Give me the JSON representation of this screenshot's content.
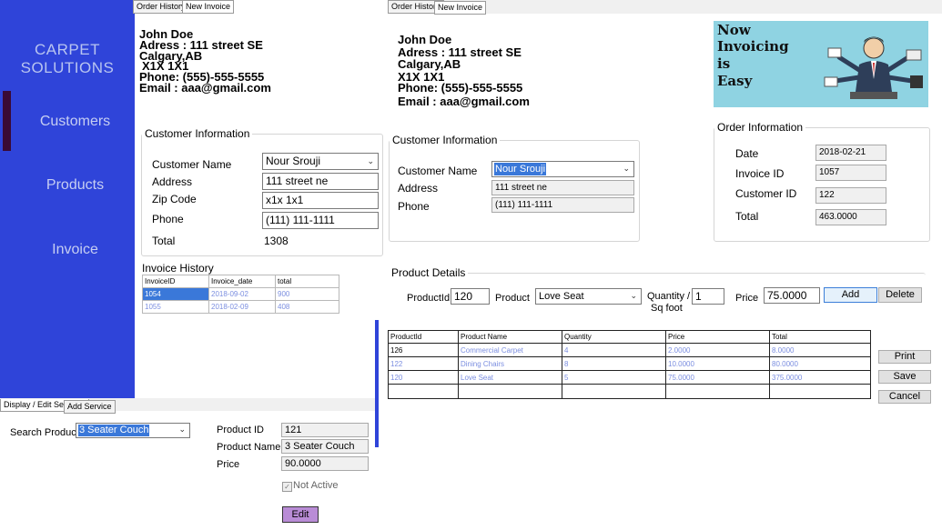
{
  "sidebar": {
    "brand_line1": "CARPET",
    "brand_line2": "SOLUTIONS",
    "items": [
      "Customers",
      "Products",
      "Invoice"
    ]
  },
  "tabs_left": [
    "Order History",
    "New Invoice"
  ],
  "tabs_right": [
    "Order History",
    "New Invoice"
  ],
  "tabs_services": [
    "Display / Edit Services",
    "Add Service"
  ],
  "company_left": {
    "name": "John Doe",
    "address": "Adress : 111 street SE",
    "city": "Calgary,AB",
    "postal": "X1X 1X1",
    "phone": "Phone: (555)-555-5555",
    "email": "Email : aaa@gmail.com"
  },
  "company_right": {
    "name": "John Doe",
    "address": "Adress : 111 street SE",
    "city": "Calgary,AB",
    "postal": "X1X 1X1",
    "phone": "Phone: (555)-555-5555",
    "email": "Email : aaa@gmail.com"
  },
  "customer_left": {
    "legend": "Customer Information",
    "name_label": "Customer Name",
    "name_value": "Nour Srouji",
    "address_label": "Address",
    "address_value": "111 street ne",
    "zip_label": "Zip Code",
    "zip_value": "x1x 1x1",
    "phone_label": "Phone",
    "phone_value": "(111) 111-1111",
    "total_label": "Total",
    "total_value": "1308"
  },
  "invoice_history": {
    "title": "Invoice History",
    "columns": [
      "InvoiceID",
      "Invoice_date",
      "total"
    ],
    "rows": [
      [
        "1054",
        "2018-09-02",
        "900"
      ],
      [
        "1055",
        "2018-02-09",
        "408"
      ]
    ]
  },
  "customer_right": {
    "legend": "Customer Information",
    "name_label": "Customer Name",
    "name_value": "Nour Srouji",
    "address_label": "Address",
    "address_value": "111 street ne",
    "phone_label": "Phone",
    "phone_value": "(111) 111-1111"
  },
  "banner": {
    "line1": "Now",
    "line2": "Invoicing",
    "line3": "is",
    "line4": "Easy"
  },
  "order_info": {
    "legend": "Order Information",
    "date_label": "Date",
    "date_value": "2018-02-21",
    "invoice_label": "Invoice ID",
    "invoice_value": "1057",
    "customer_label": "Customer ID",
    "customer_value": "122",
    "total_label": "Total",
    "total_value": "463.0000"
  },
  "product_details": {
    "legend": "Product Details",
    "pid_label": "ProductId",
    "pid_value": "120",
    "product_label": "Product",
    "product_value": "Love Seat",
    "qty_label_1": "Quantity /",
    "qty_label_2": "Sq foot",
    "qty_value": "1",
    "price_label": "Price",
    "price_value": "75.0000",
    "add_label": "Add",
    "delete_label": "Delete"
  },
  "order_grid": {
    "columns": [
      "ProductId",
      "Product Name",
      "Quantity",
      "Price",
      "Total"
    ],
    "rows": [
      [
        "126",
        "Commercial Carpet",
        "4",
        "2.0000",
        "8.0000"
      ],
      [
        "122",
        "Dining Chairs",
        "8",
        "10.0000",
        "80.0000"
      ],
      [
        "120",
        "Love Seat",
        "5",
        "75.0000",
        "375.0000"
      ]
    ]
  },
  "actions": {
    "print": "Print",
    "save": "Save",
    "cancel": "Cancel"
  },
  "services": {
    "search_label": "Search Product",
    "search_value": "3 Seater Couch",
    "pid_label": "Product ID",
    "pid_value": "121",
    "pname_label": "Product Name",
    "pname_value": "3 Seater Couch",
    "price_label": "Price",
    "price_value": "90.0000",
    "not_active_label": "Not Active",
    "edit_label": "Edit"
  }
}
